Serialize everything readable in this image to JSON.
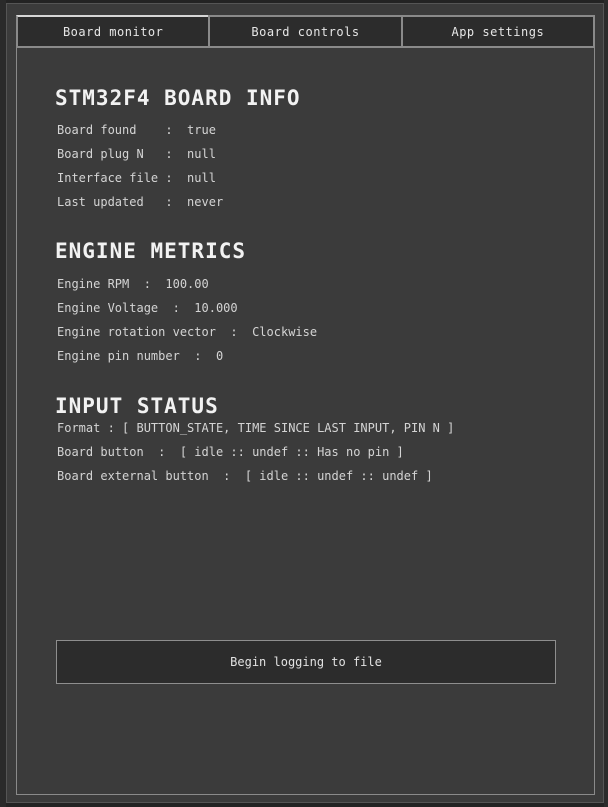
{
  "tabs": [
    {
      "label": "Board monitor"
    },
    {
      "label": "Board controls"
    },
    {
      "label": "App settings"
    }
  ],
  "board_info": {
    "title": "STM32F4 BOARD INFO",
    "rows": [
      "Board found    :  true",
      "Board plug N   :  null",
      "Interface file :  null",
      "Last updated   :  never"
    ]
  },
  "engine_metrics": {
    "title": "ENGINE METRICS",
    "rows": [
      "Engine RPM  :  100.00",
      "Engine Voltage  :  10.000",
      "Engine rotation vector  :  Clockwise",
      "Engine pin number  :  0"
    ]
  },
  "input_status": {
    "title": "INPUT STATUS",
    "rows": [
      "Format : [ BUTTON_STATE, TIME SINCE LAST INPUT, PIN N ]",
      "Board button  :  [ idle :: undef :: Has no pin ]",
      "Board external button  :  [ idle :: undef :: undef ]"
    ]
  },
  "actions": {
    "log_button": "Begin logging to file"
  }
}
